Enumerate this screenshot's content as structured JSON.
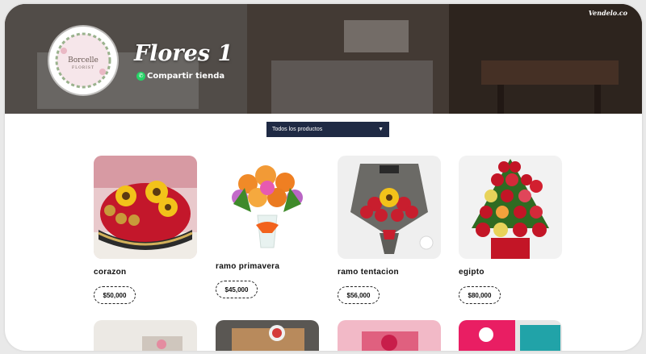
{
  "header": {
    "brand_tag": "Vendelo.co",
    "store_name": "Flores 1",
    "share_label": "Compartir tienda",
    "logo_name": "Borcelle",
    "logo_sub": "FLORIST"
  },
  "filter": {
    "label": "Todos los productos"
  },
  "products": [
    {
      "name": "corazon",
      "price": "$50,000"
    },
    {
      "name": "ramo primavera",
      "price": "$45,000"
    },
    {
      "name": "ramo tentacion",
      "price": "$56,000"
    },
    {
      "name": "egipto",
      "price": "$80,000"
    }
  ],
  "icons": {
    "share": "whatsapp-icon",
    "filter_arrow": "caret-down-icon"
  },
  "colors": {
    "filter_bg": "#1f2a44",
    "whatsapp": "#25d366"
  }
}
